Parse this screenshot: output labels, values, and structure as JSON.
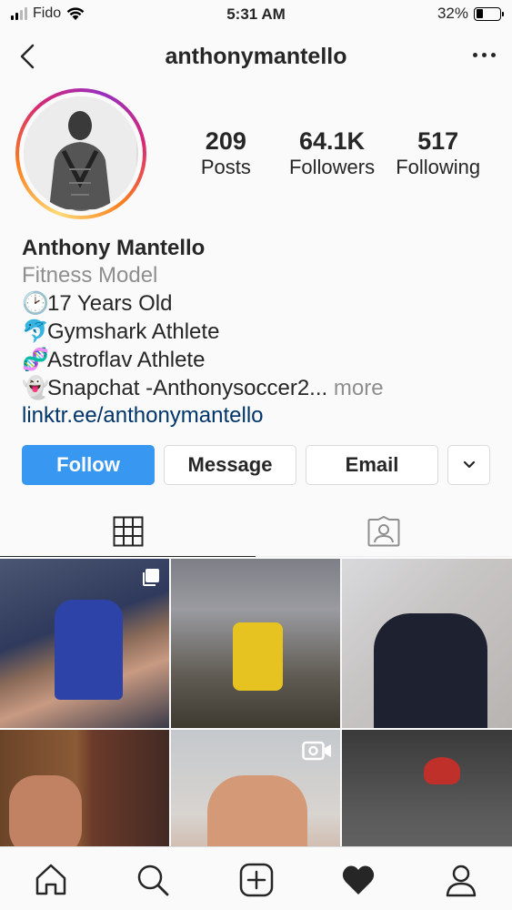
{
  "status_bar": {
    "carrier": "Fido",
    "time": "5:31 AM",
    "battery_percent": "32%",
    "battery_level": 0.32
  },
  "nav": {
    "username": "anthonymantello",
    "back_icon": "chevron-left-icon",
    "more_icon": "more-horizontal-icon"
  },
  "stats": [
    {
      "value": "209",
      "label": "Posts"
    },
    {
      "value": "64.1K",
      "label": "Followers"
    },
    {
      "value": "517",
      "label": "Following"
    }
  ],
  "bio": {
    "name": "Anthony Mantello",
    "category": "Fitness Model",
    "lines": [
      {
        "emoji": "🕑",
        "text": "17 Years Old"
      },
      {
        "emoji": "🐬",
        "text": "Gymshark Athlete"
      },
      {
        "emoji": "🧬",
        "text": "Astroflav Athlete"
      },
      {
        "emoji": "👻",
        "text": "Snapchat -Anthonysoccer2..."
      }
    ],
    "more": " more",
    "link": "linktr.ee/anthonymantello"
  },
  "buttons": {
    "follow": "Follow",
    "message": "Message",
    "email": "Email",
    "dropdown_icon": "chevron-down-icon"
  },
  "tabs": [
    {
      "icon": "grid-icon",
      "active": true
    },
    {
      "icon": "tagged-icon",
      "active": false
    }
  ],
  "grid": [
    {
      "badge": "multiple-posts-icon"
    },
    {
      "badge": ""
    },
    {
      "badge": ""
    },
    {
      "badge": ""
    },
    {
      "badge": "video-icon"
    },
    {
      "badge": ""
    }
  ],
  "bottom_nav": [
    "home-icon",
    "search-icon",
    "new-post-icon",
    "activity-heart-icon",
    "profile-icon"
  ],
  "colors": {
    "follow_button": "#3897f0",
    "link": "#003569",
    "secondary_text": "#8e8e8e"
  }
}
